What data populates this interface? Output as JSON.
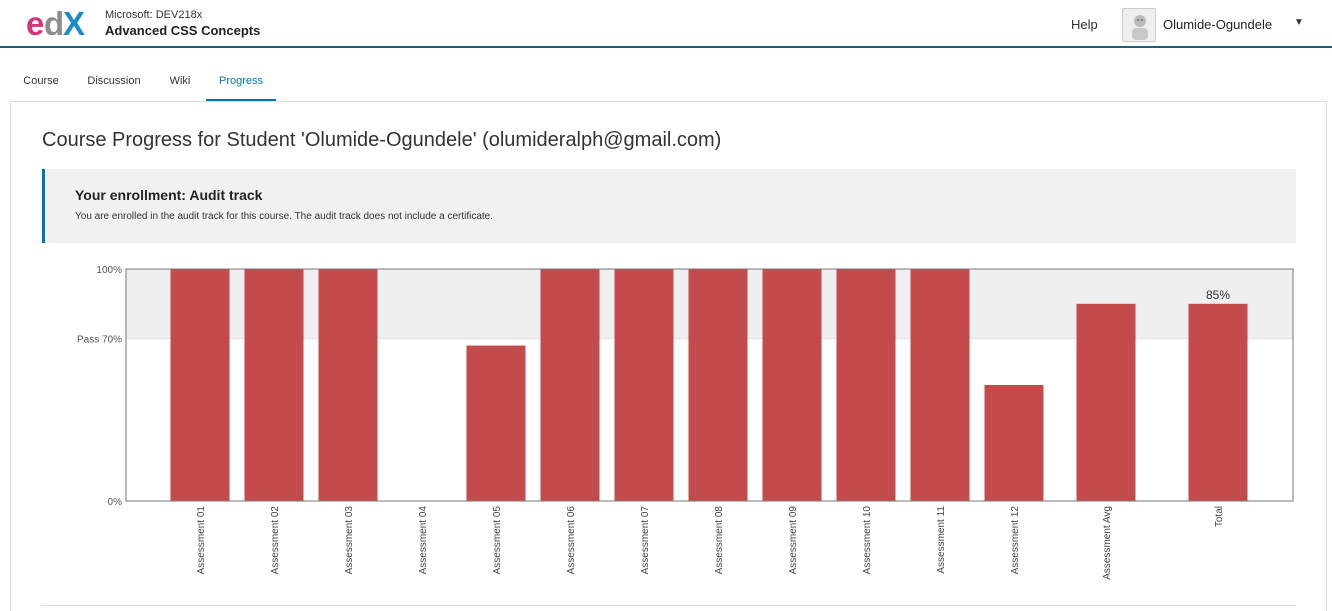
{
  "header": {
    "org": "Microsoft: DEV218x",
    "course_name": "Advanced CSS Concepts",
    "help": "Help",
    "username": "Olumide-Ogundele",
    "logo": "edX"
  },
  "tabs": [
    {
      "label": "Course",
      "active": false
    },
    {
      "label": "Discussion",
      "active": false
    },
    {
      "label": "Wiki",
      "active": false
    },
    {
      "label": "Progress",
      "active": true
    }
  ],
  "page": {
    "title": "Course Progress for Student 'Olumide-Ogundele' (olumideralph@gmail.com)"
  },
  "enrollment": {
    "title": "Your enrollment: Audit track",
    "description": "You are enrolled in the audit track for this course. The audit track does not include a certificate."
  },
  "colors": {
    "accent": "#0075b4",
    "bar": "#c44b4b",
    "pass_band": "#efefef",
    "logo_e": "#d2357b",
    "logo_d": "#8a8c8f",
    "logo_x": "#1b8cc7"
  },
  "chart_data": {
    "type": "bar",
    "categories": [
      "Assessment 01",
      "Assessment 02",
      "Assessment 03",
      "Assessment 04",
      "Assessment 05",
      "Assessment 06",
      "Assessment 07",
      "Assessment 08",
      "Assessment 09",
      "Assessment 10",
      "Assessment 11",
      "Assessment 12",
      "Assessment Avg",
      "Total"
    ],
    "values": [
      100,
      100,
      100,
      0,
      67,
      100,
      100,
      100,
      100,
      100,
      100,
      50,
      85,
      85
    ],
    "yticks": [
      {
        "value": 100,
        "label": "100%"
      },
      {
        "value": 70,
        "label": "Pass 70%"
      },
      {
        "value": 0,
        "label": "0%"
      }
    ],
    "ylim": [
      0,
      100
    ],
    "pass_threshold": 70,
    "annotations": [
      {
        "category": "Total",
        "text": "85%"
      }
    ]
  }
}
